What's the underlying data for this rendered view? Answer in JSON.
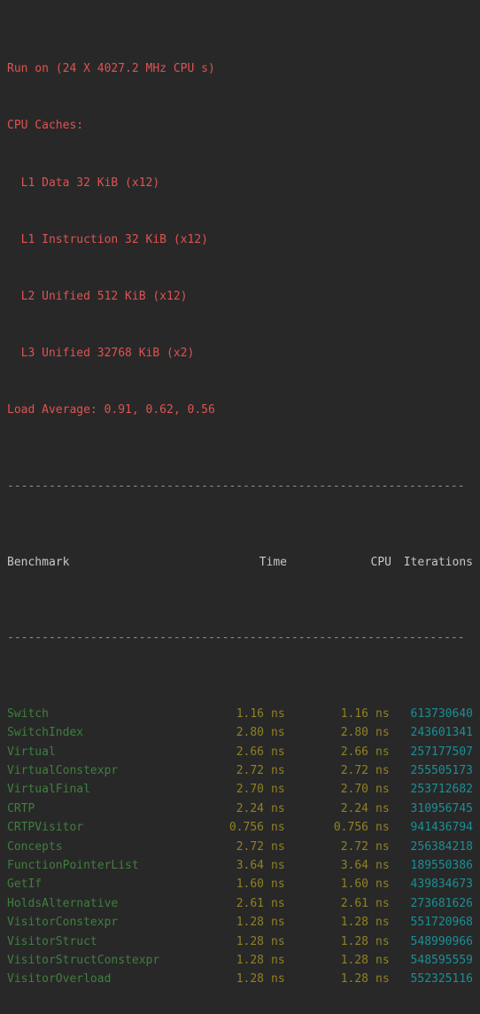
{
  "system_info": {
    "run_on": "Run on (24 X 4027.2 MHz CPU s)",
    "caches_label": "CPU Caches:",
    "caches": [
      "  L1 Data 32 KiB (x12)",
      "  L1 Instruction 32 KiB (x12)",
      "  L2 Unified 512 KiB (x12)",
      "  L3 Unified 32768 KiB (x2)"
    ],
    "load_average": "Load Average: 0.91, 0.62, 0.56"
  },
  "separator": "------------------------------------------------------------------",
  "table": {
    "headers": {
      "benchmark": "Benchmark",
      "time": "Time",
      "cpu": "CPU",
      "iterations": "Iterations"
    },
    "unit": "ns",
    "rows": [
      {
        "benchmark": "Switch",
        "time": "1.16",
        "cpu": "1.16",
        "iterations": "613730640"
      },
      {
        "benchmark": "SwitchIndex",
        "time": "2.80",
        "cpu": "2.80",
        "iterations": "243601341"
      },
      {
        "benchmark": "Virtual",
        "time": "2.66",
        "cpu": "2.66",
        "iterations": "257177507"
      },
      {
        "benchmark": "VirtualConstexpr",
        "time": "2.72",
        "cpu": "2.72",
        "iterations": "255505173"
      },
      {
        "benchmark": "VirtualFinal",
        "time": "2.70",
        "cpu": "2.70",
        "iterations": "253712682"
      },
      {
        "benchmark": "CRTP",
        "time": "2.24",
        "cpu": "2.24",
        "iterations": "310956745"
      },
      {
        "benchmark": "CRTPVisitor",
        "time": "0.756",
        "cpu": "0.756",
        "iterations": "941436794"
      },
      {
        "benchmark": "Concepts",
        "time": "2.72",
        "cpu": "2.72",
        "iterations": "256384218"
      },
      {
        "benchmark": "FunctionPointerList",
        "time": "3.64",
        "cpu": "3.64",
        "iterations": "189550386"
      },
      {
        "benchmark": "GetIf",
        "time": "1.60",
        "cpu": "1.60",
        "iterations": "439834673"
      },
      {
        "benchmark": "HoldsAlternative",
        "time": "2.61",
        "cpu": "2.61",
        "iterations": "273681626"
      },
      {
        "benchmark": "VisitorConstexpr",
        "time": "1.28",
        "cpu": "1.28",
        "iterations": "551720968"
      },
      {
        "benchmark": "VisitorStruct",
        "time": "1.28",
        "cpu": "1.28",
        "iterations": "548990966"
      },
      {
        "benchmark": "VisitorStructConstexpr",
        "time": "1.28",
        "cpu": "1.28",
        "iterations": "548595559"
      },
      {
        "benchmark": "VisitorOverload",
        "time": "1.28",
        "cpu": "1.28",
        "iterations": "552325116"
      }
    ]
  },
  "colors": {
    "background": "#282828",
    "sysinfo": "#e05252",
    "rule": "#8f8f8f",
    "column_header": "#c5c8c6",
    "benchmark_name": "#3f7f3f",
    "timing": "#8f8223",
    "iterations": "#1a8f96"
  }
}
